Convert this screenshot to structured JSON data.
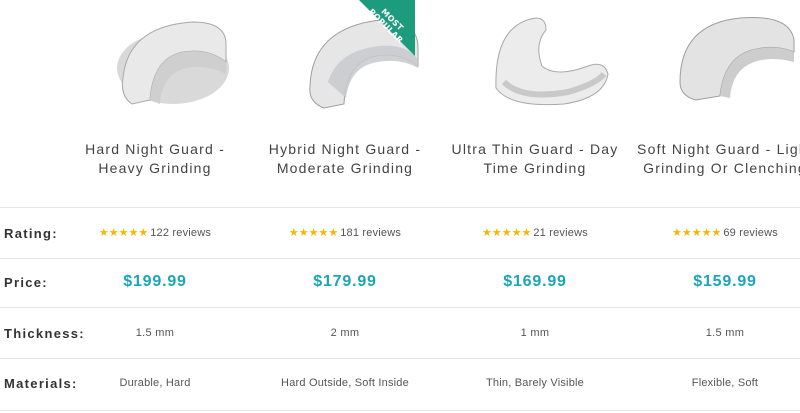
{
  "badge": {
    "text": "MOST POPULAR"
  },
  "rows": {
    "rating_label": "Rating:",
    "price_label": "Price:",
    "thickness_label": "Thickness:",
    "materials_label": "Materials:"
  },
  "products": [
    {
      "name": "Hard Night Guard - Heavy Grinding",
      "stars": "★★★★★",
      "rating": 5,
      "reviews": "122 reviews",
      "price": "$199.99",
      "thickness": "1.5 mm",
      "materials": "Durable, Hard",
      "image_icon": "hard-night-guard-image"
    },
    {
      "name": "Hybrid Night Guard - Moderate Grinding",
      "stars": "★★★★★",
      "rating": 5,
      "reviews": "181 reviews",
      "price": "$179.99",
      "thickness": "2 mm",
      "materials": "Hard Outside, Soft Inside",
      "image_icon": "hybrid-night-guard-image"
    },
    {
      "name": "Ultra Thin Guard - Day Time Grinding",
      "stars": "★★★★★",
      "rating": 5,
      "reviews": "21 reviews",
      "price": "$169.99",
      "thickness": "1 mm",
      "materials": "Thin, Barely Visible",
      "image_icon": "ultra-thin-guard-image"
    },
    {
      "name": "Soft Night Guard - Light Grinding Or Clenching",
      "stars": "★★★★★",
      "rating": 5,
      "reviews": "69 reviews",
      "price": "$159.99",
      "thickness": "1.5 mm",
      "materials": "Flexible, Soft",
      "image_icon": "soft-night-guard-image"
    }
  ],
  "colors": {
    "price": "#1aa5b8",
    "stars": "#f5b800",
    "badge": "#1c9c7c"
  }
}
